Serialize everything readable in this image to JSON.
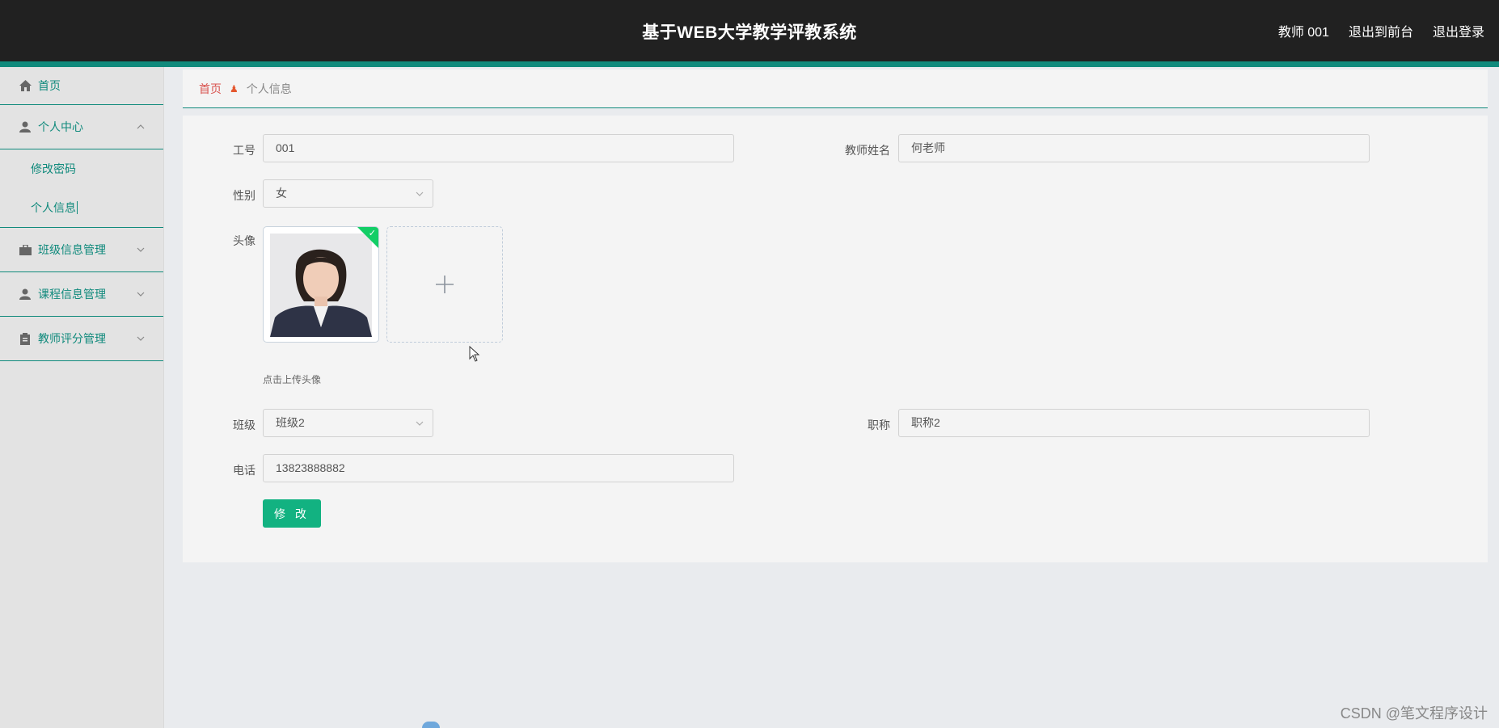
{
  "header": {
    "title": "基于WEB大学教学评教系统",
    "links": [
      "教师 001",
      "退出到前台",
      "退出登录"
    ]
  },
  "sidebar": {
    "home": "首页",
    "personal_center": "个人中心",
    "sub_items": [
      "修改密码",
      "个人信息"
    ],
    "class_mgmt": "班级信息管理",
    "course_mgmt": "课程信息管理",
    "teacher_rating_mgmt": "教师评分管理"
  },
  "breadcrumb": {
    "home": "首页",
    "current": "个人信息"
  },
  "form": {
    "employee_id_label": "工号",
    "employee_id_value": "001",
    "teacher_name_label": "教师姓名",
    "teacher_name_value": "何老师",
    "gender_label": "性别",
    "gender_value": "女",
    "avatar_label": "头像",
    "upload_hint": "点击上传头像",
    "class_label": "班级",
    "class_value": "班级2",
    "title_label": "职称",
    "title_value": "职称2",
    "phone_label": "电话",
    "phone_value": "13823888882",
    "submit_label": "修 改"
  },
  "watermark": "CSDN @笔文程序设计",
  "colors": {
    "accent": "#108a7c",
    "button": "#12b281",
    "header_bg": "#212121"
  }
}
